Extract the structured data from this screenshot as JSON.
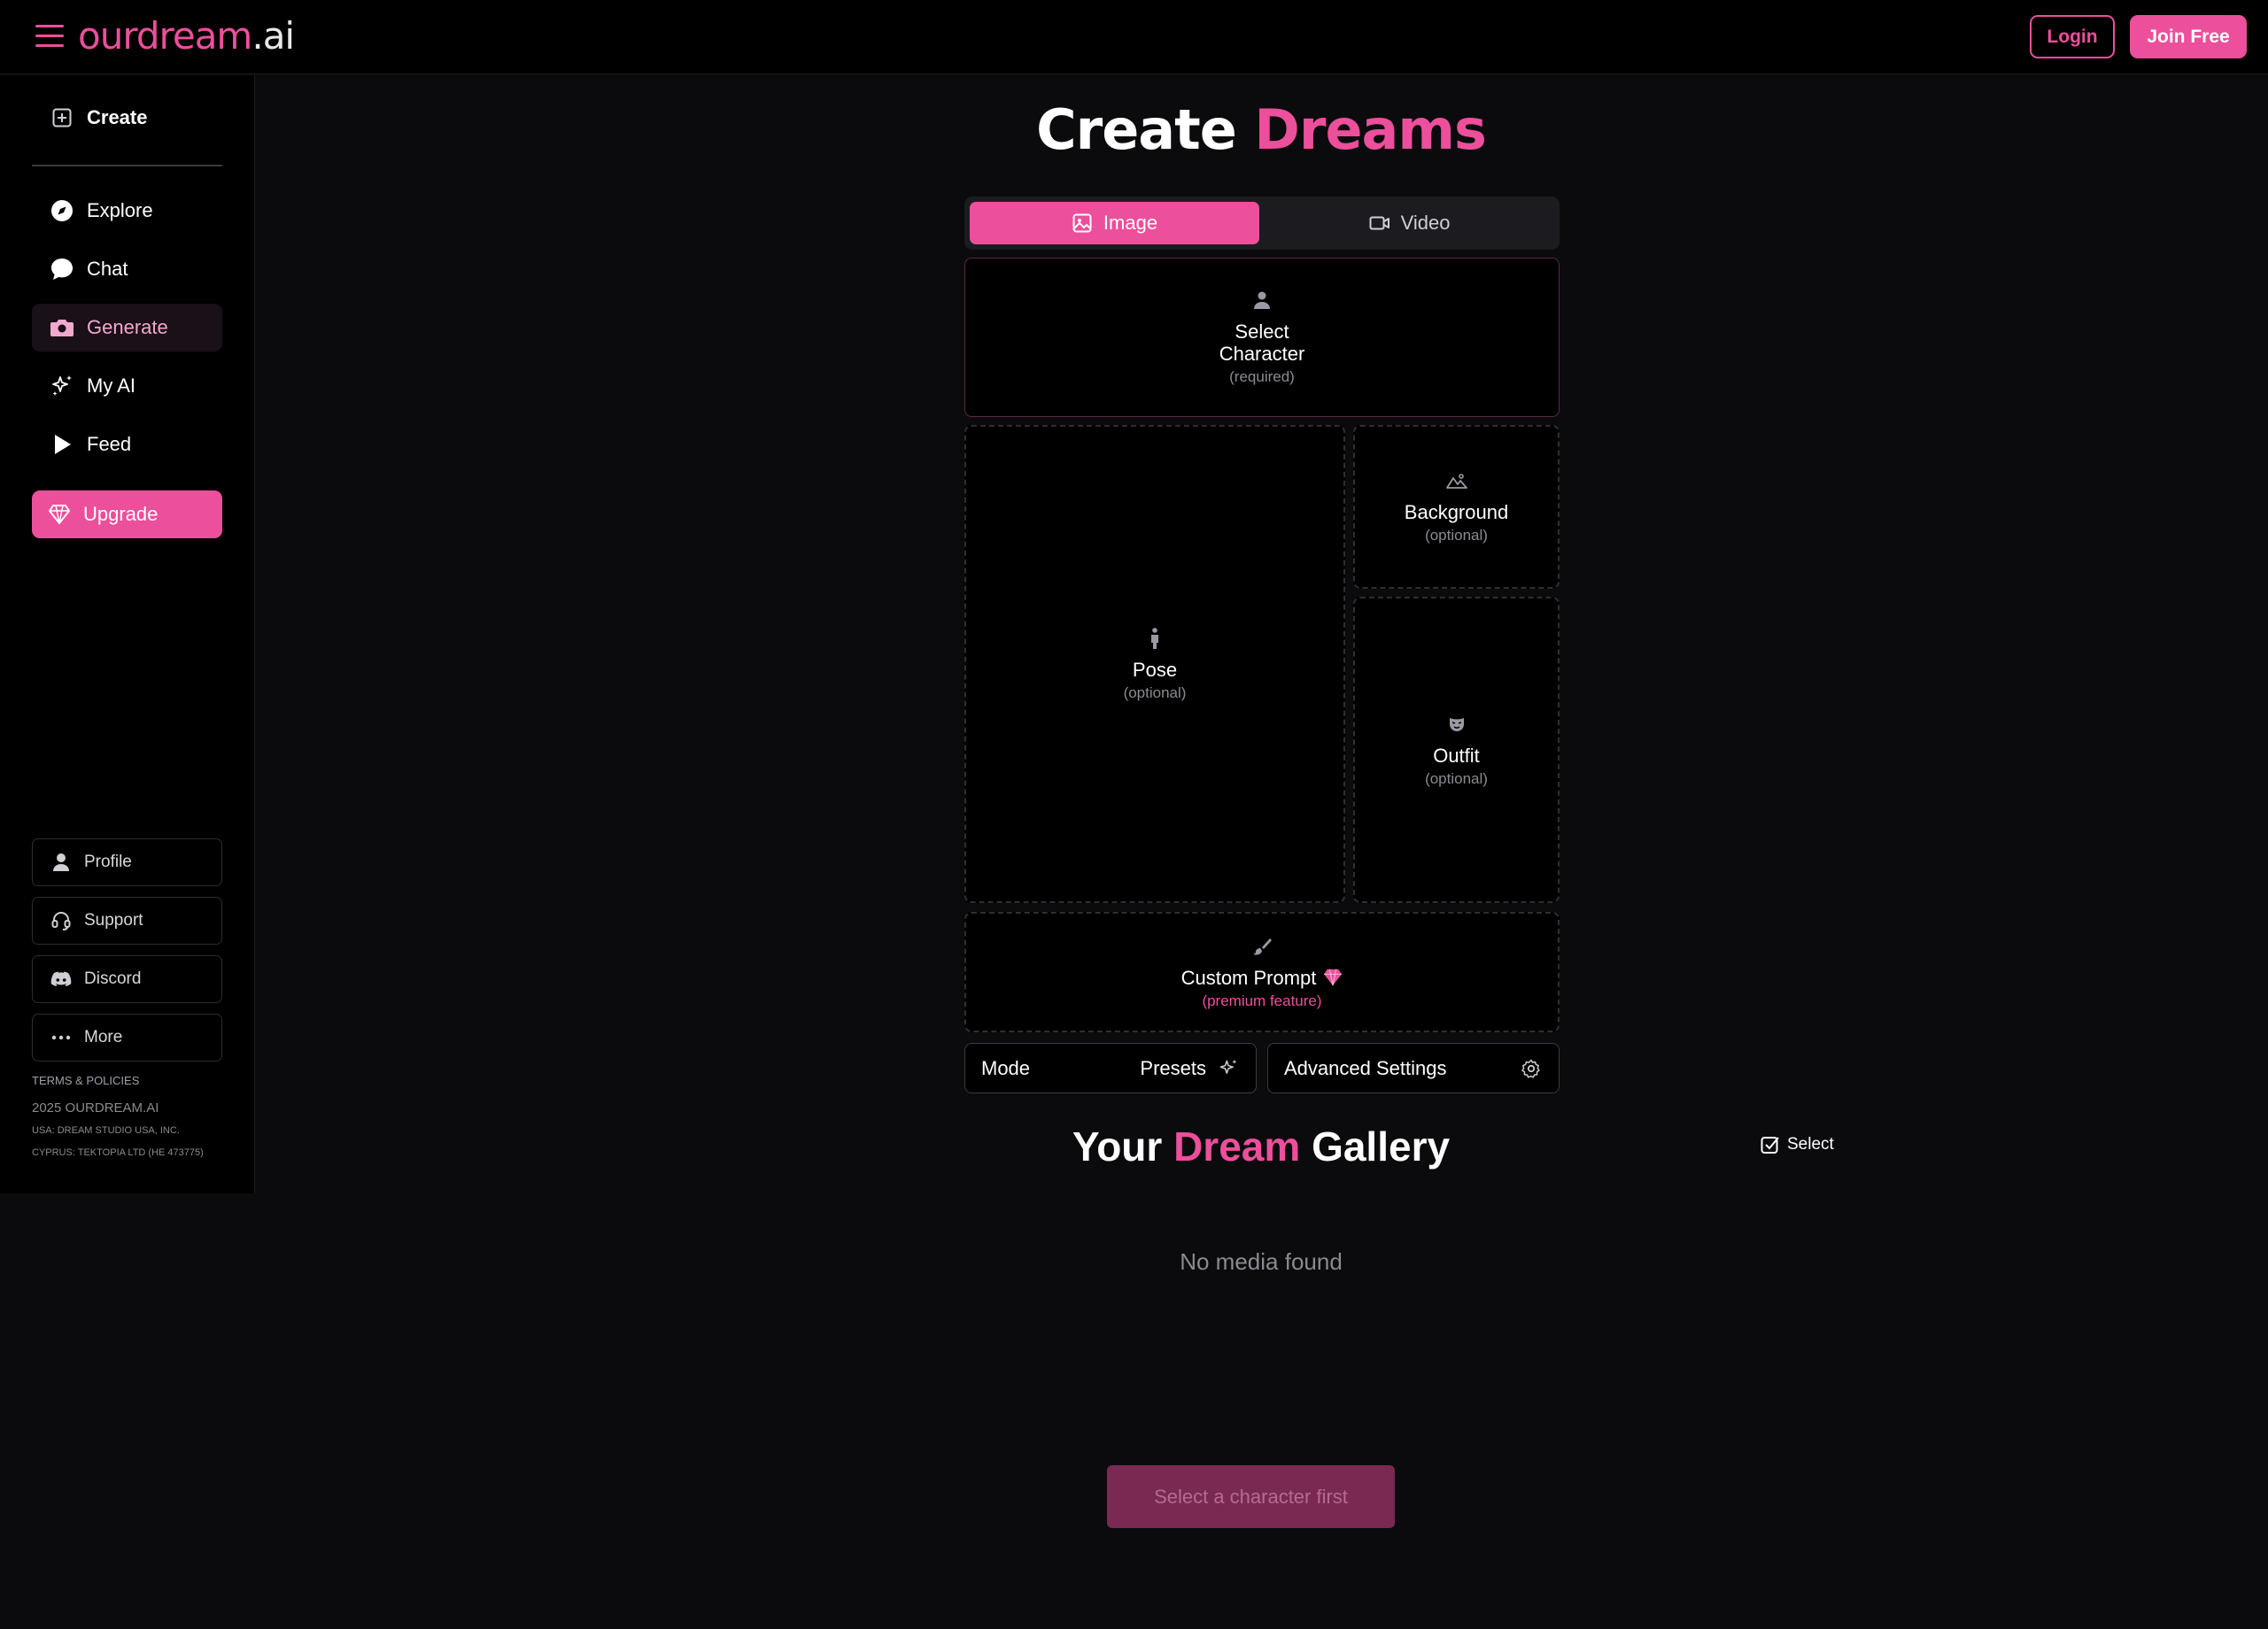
{
  "header": {
    "logo_brand": "ourdream",
    "logo_tld": ".ai",
    "login_label": "Login",
    "join_label": "Join Free"
  },
  "sidebar": {
    "create_label": "Create",
    "items": [
      {
        "label": "Explore",
        "icon": "compass-icon"
      },
      {
        "label": "Chat",
        "icon": "chat-bubble-icon"
      },
      {
        "label": "Generate",
        "icon": "camera-icon",
        "active": true
      },
      {
        "label": "My AI",
        "icon": "sparkles-icon"
      },
      {
        "label": "Feed",
        "icon": "play-icon"
      }
    ],
    "upgrade_label": "Upgrade",
    "bottom_items": [
      {
        "label": "Profile",
        "icon": "user-icon"
      },
      {
        "label": "Support",
        "icon": "headset-icon"
      },
      {
        "label": "Discord",
        "icon": "discord-icon"
      },
      {
        "label": "More",
        "icon": "ellipsis-icon"
      }
    ],
    "terms": "TERMS & POLICIES",
    "copyright": "2025 OURDREAM.AI",
    "legal_usa": "USA: DREAM STUDIO USA, INC.",
    "legal_cyprus": "CYPRUS: TEKTOPIA LTD (HE 473775)"
  },
  "main": {
    "title_part1": "Create",
    "title_part2": "Dreams",
    "tabs": [
      {
        "label": "Image",
        "active": true
      },
      {
        "label": "Video",
        "active": false
      }
    ],
    "slots": {
      "character_title_line1": "Select",
      "character_title_line2": "Character",
      "character_sub": "(required)",
      "pose_title": "Pose",
      "pose_sub": "(optional)",
      "background_title": "Background",
      "background_sub": "(optional)",
      "outfit_title": "Outfit",
      "outfit_sub": "(optional)",
      "prompt_title": "Custom Prompt",
      "prompt_sub": "(premium feature)"
    },
    "mode_label": "Mode",
    "presets_label": "Presets",
    "advanced_label": "Advanced Settings",
    "gallery_part1": "Your",
    "gallery_part2": "Dream",
    "gallery_part3": "Gallery",
    "select_label": "Select",
    "empty_text": "No media found",
    "cta_label": "Select a character first"
  },
  "colors": {
    "accent": "#ec4f9b",
    "background": "#0b0b0d",
    "panel": "#000000"
  }
}
